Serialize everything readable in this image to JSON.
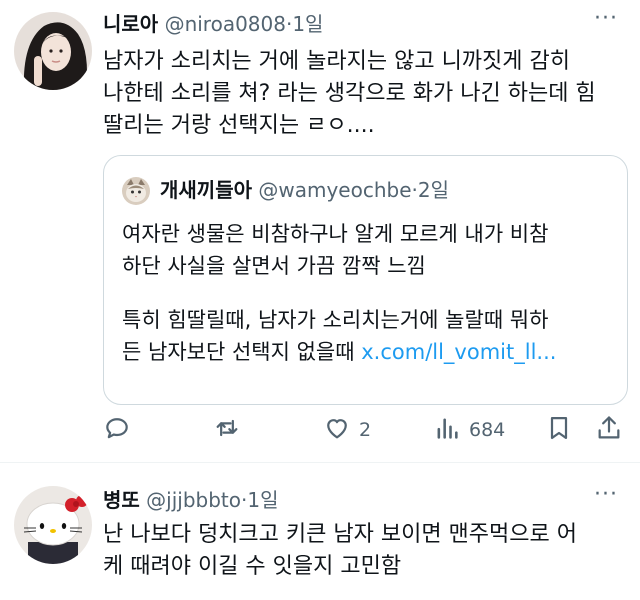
{
  "tweets": [
    {
      "author": {
        "name": "니로아",
        "handle": "@niroa0808",
        "time": "1일"
      },
      "more_label": "···",
      "lines": [
        "남자가 소리치는 거에 놀라지는 않고 니까짓게 감히",
        "나한테 소리를 쳐? 라는 생각으로 화가 나긴 하는데 힘",
        "딸리는 거랑 선택지는 ㄹㅇ...."
      ],
      "quote": {
        "author": {
          "name": "개새끼들아",
          "handle": "@wamyeochbe",
          "time": "2일"
        },
        "lines": [
          "여자란 생물은 비참하구나 알게 모르게 내가 비참",
          "하단 사실을 살면서 가끔 깜짝 느낌",
          "특히 힘딸릴때, 남자가 소리치는거에 놀랄때 뭐하",
          "든 남자보단 선택지 없을때"
        ],
        "link": "x.com/ll_vomit_ll..."
      },
      "actions": {
        "reply": "",
        "retweet": "",
        "like": "2",
        "views": "684"
      }
    },
    {
      "author": {
        "name": "병또",
        "handle": "@jjjbbbto",
        "time": "1일"
      },
      "more_label": "···",
      "lines": [
        "난 나보다 덩치크고 키큰 남자 보이면 맨주먹으로 어",
        "케 때려야 이길 수 잇을지 고민함"
      ]
    }
  ],
  "separator": "·",
  "icons": [
    "reply-icon",
    "retweet-icon",
    "like-icon",
    "views-icon",
    "bookmark-icon",
    "share-icon",
    "more-icon"
  ],
  "colors": {
    "text": "#0f1419",
    "secondary": "#536471",
    "link": "#1d9bf0",
    "border": "#cfd9de"
  }
}
